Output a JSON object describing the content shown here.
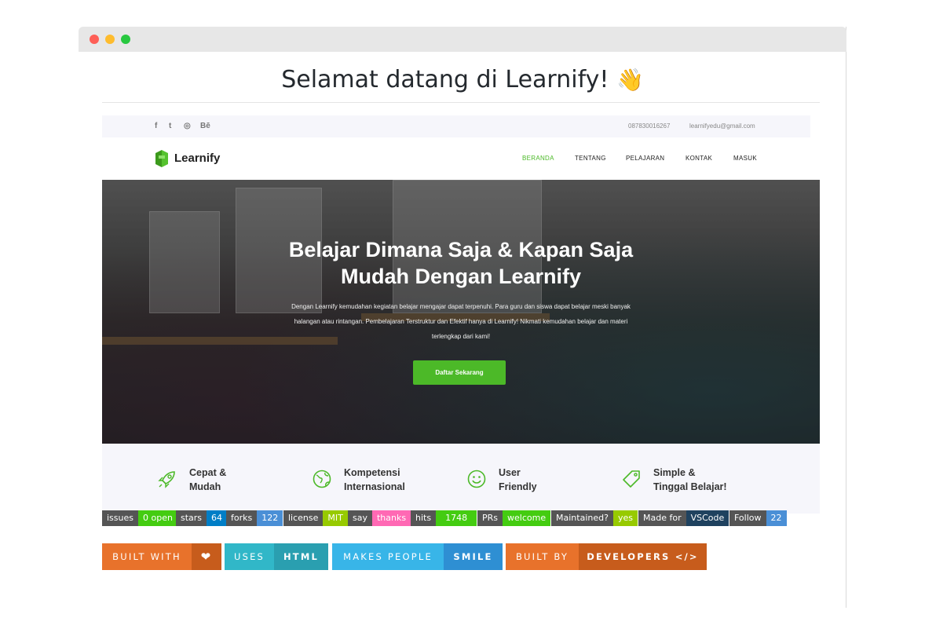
{
  "window": {
    "dots": [
      "#fe5f57",
      "#febc2e",
      "#28c840"
    ]
  },
  "readme": {
    "heading": "Selamat datang di Learnify!",
    "wave_emoji": "👋"
  },
  "site": {
    "topbar": {
      "social": [
        "f",
        "t",
        "◎",
        "Bē"
      ],
      "phone": "087830016267",
      "email": "learnifyedu@gmail.com"
    },
    "nav": {
      "logo": "Learnify",
      "menu": [
        {
          "label": "BERANDA",
          "active": true
        },
        {
          "label": "TENTANG",
          "active": false
        },
        {
          "label": "PELAJARAN",
          "active": false
        },
        {
          "label": "KONTAK",
          "active": false
        },
        {
          "label": "MASUK",
          "active": false
        }
      ]
    },
    "hero": {
      "title_line1": "Belajar Dimana Saja & Kapan Saja",
      "title_line2": "Mudah Dengan Learnify",
      "desc": "Dengan Learnify kemudahan kegiatan belajar mengajar dapat terpenuhi. Para guru dan siswa dapat belajar meski banyak halangan atau rintangan. Pembelajaran Terstruktur dan Efektif hanya di Learnify! Nikmati kemudahan belajar dan materi terlengkap dari kami!",
      "cta": "Daftar Sekarang"
    },
    "features": [
      {
        "icon": "rocket-icon",
        "line1": "Cepat &",
        "line2": "Mudah"
      },
      {
        "icon": "globe-icon",
        "line1": "Kompetensi",
        "line2": "Internasional"
      },
      {
        "icon": "smile-icon",
        "line1": "User",
        "line2": "Friendly"
      },
      {
        "icon": "tag-icon",
        "line1": "Simple &",
        "line2": "Tinggal Belajar!"
      }
    ],
    "accent_color": "#4cb928"
  },
  "badges": [
    {
      "label": "issues",
      "value": "0 open",
      "color": "#4c1"
    },
    {
      "label": "stars",
      "value": "64",
      "color": "#007ec6"
    },
    {
      "label": "forks",
      "value": "122",
      "color": "#4a8fd6"
    },
    {
      "label": "license",
      "value": "MIT",
      "color": "#97ca00"
    },
    {
      "label": "say",
      "value": "thanks",
      "color": "#ff69b4"
    },
    {
      "label": "hits",
      "value": "1748",
      "color": "#4c1"
    },
    {
      "label": "PRs",
      "value": "welcome",
      "color": "#4c1"
    },
    {
      "label": "Maintained?",
      "value": "yes",
      "color": "#97ca00"
    },
    {
      "label": "Made for",
      "value": "VSCode",
      "color": "#1f425f"
    },
    {
      "label": "Follow",
      "value": "22",
      "color": "#4a8fd6"
    }
  ],
  "big_badges": [
    {
      "label": "BUILT WITH",
      "value": "❤",
      "left_color": "#e8722b",
      "right_color": "#c75c1c"
    },
    {
      "label": "USES",
      "value": "HTML",
      "left_color": "#31b7c8",
      "right_color": "#2a9fb0"
    },
    {
      "label": "MAKES PEOPLE",
      "value": "SMILE",
      "left_color": "#38b5e8",
      "right_color": "#2e8fd3"
    },
    {
      "label": "BUILT BY",
      "value": "DEVELOPERS </>",
      "left_color": "#e8722b",
      "right_color": "#c75c1c"
    }
  ]
}
